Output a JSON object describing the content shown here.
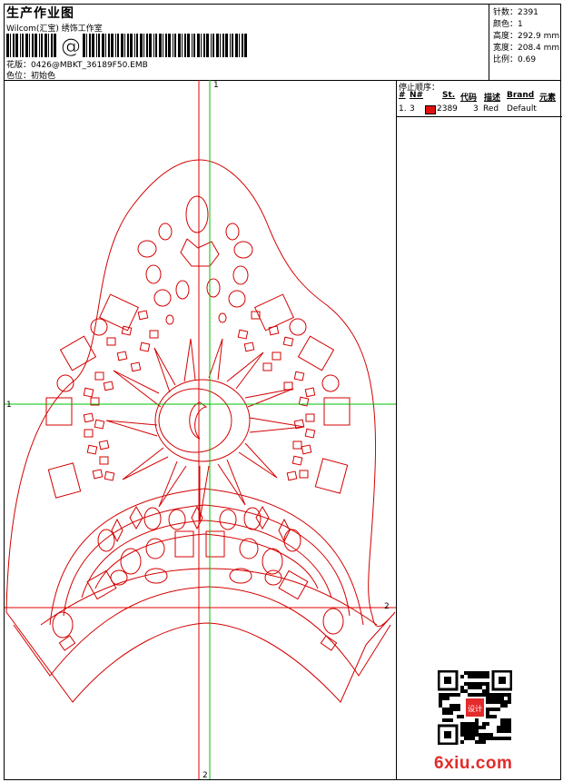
{
  "header": {
    "title": "生产作业图",
    "subtitle": "Wilcom(汇宝) 绣饰工作室",
    "barcode_symbol": "@",
    "design_line": "花版：0426@MBKT_36189F50.EMB",
    "color_line": "色位：初始色"
  },
  "stats": [
    "针数：2391",
    "颜色：1",
    "高度：292.9 mm",
    "宽度：208.4 mm",
    "比例：0.69"
  ],
  "stop_sequence": {
    "title": "停止顺序：",
    "columns": [
      "#",
      "N#",
      "St.",
      "代码",
      "描述",
      "Brand",
      "元素"
    ],
    "rows": [
      {
        "index": "1.",
        "needle": "3",
        "stitches": "2389",
        "code": "3",
        "description": "Red",
        "brand": "Default",
        "element": ""
      }
    ]
  },
  "design": {
    "markers": {
      "left": "1",
      "top": "1",
      "right": "2",
      "bottom": "2"
    },
    "colors": {
      "outline": "#d40000",
      "guide_green": "#00c000",
      "guide_red": "#e00000"
    }
  },
  "watermark": {
    "text": "6xiu.com",
    "stamp_text": "设计",
    "color": "#e32b2b"
  }
}
